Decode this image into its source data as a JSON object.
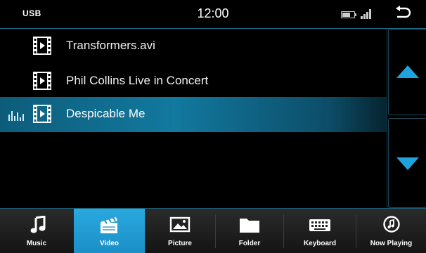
{
  "status": {
    "source": "USB",
    "time": "12:00"
  },
  "playlist": [
    {
      "title": "Transformers.avi",
      "playing": false
    },
    {
      "title": "Phil Collins Live in Concert",
      "playing": false
    },
    {
      "title": "Despicable Me",
      "playing": true
    }
  ],
  "tabs": [
    {
      "label": "Music",
      "icon": "music-note-icon",
      "active": false
    },
    {
      "label": "Video",
      "icon": "clapperboard-icon",
      "active": true
    },
    {
      "label": "Picture",
      "icon": "picture-icon",
      "active": false
    },
    {
      "label": "Folder",
      "icon": "folder-icon",
      "active": false
    },
    {
      "label": "Keyboard",
      "icon": "keyboard-icon",
      "active": false
    },
    {
      "label": "Now Playing",
      "icon": "now-playing-icon",
      "active": false
    }
  ],
  "colors": {
    "accent": "#29a9df",
    "highlight": "#12799f",
    "arrow": "#1fa3dd"
  }
}
